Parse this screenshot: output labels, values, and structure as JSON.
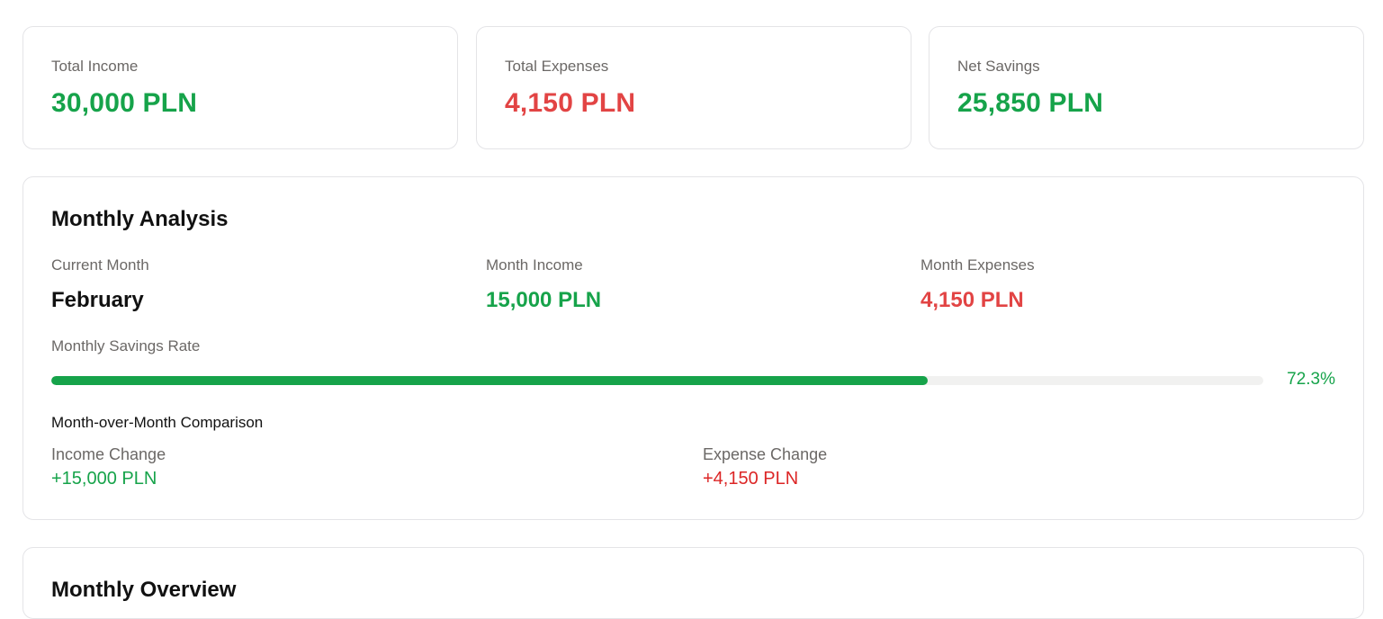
{
  "summary": {
    "total_income": {
      "label": "Total Income",
      "value": "30,000 PLN"
    },
    "total_expenses": {
      "label": "Total Expenses",
      "value": "4,150 PLN"
    },
    "net_savings": {
      "label": "Net Savings",
      "value": "25,850 PLN"
    }
  },
  "monthly_analysis": {
    "title": "Monthly Analysis",
    "current_month": {
      "label": "Current Month",
      "value": "February"
    },
    "month_income": {
      "label": "Month Income",
      "value": "15,000 PLN"
    },
    "month_expenses": {
      "label": "Month Expenses",
      "value": "4,150 PLN"
    },
    "savings_rate": {
      "label": "Monthly Savings Rate",
      "value_text": "72.3%",
      "fraction": 0.723
    },
    "comparison": {
      "title": "Month-over-Month Comparison",
      "income_change": {
        "label": "Income Change",
        "value": "+15,000 PLN"
      },
      "expense_change": {
        "label": "Expense Change",
        "value": "+4,150 PLN"
      }
    }
  },
  "monthly_overview": {
    "title": "Monthly Overview"
  },
  "colors": {
    "positive": "#16a34a",
    "negative": "#e24444"
  }
}
